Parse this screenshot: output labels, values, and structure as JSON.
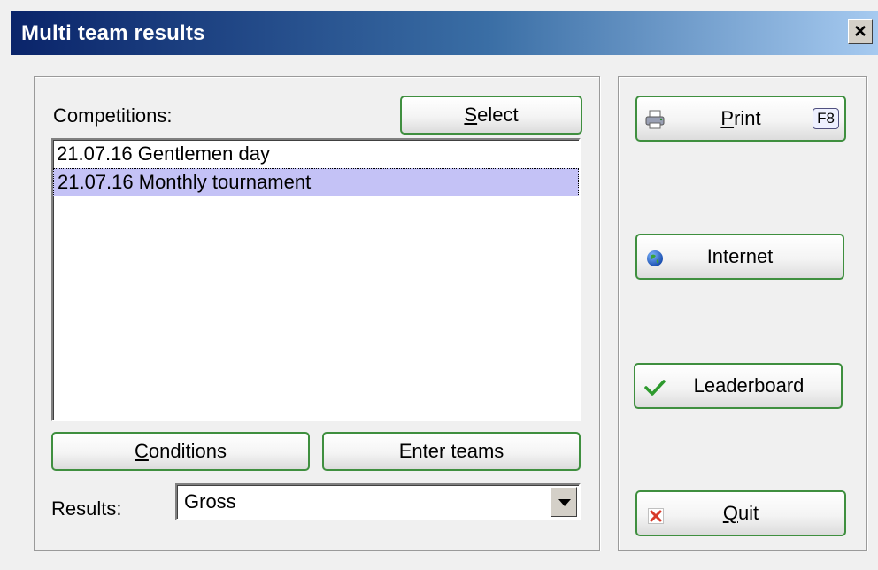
{
  "window": {
    "title": "Multi team results",
    "close_label": "×"
  },
  "left": {
    "competitions_label": "Competitions:",
    "select_button": {
      "mnemonic": "S",
      "rest": "elect"
    },
    "competitions": [
      {
        "label": "21.07.16 Gentlemen day",
        "selected": false
      },
      {
        "label": "21.07.16 Monthly tournament",
        "selected": true
      }
    ],
    "conditions_button": {
      "mnemonic": "C",
      "rest": "onditions"
    },
    "enter_teams_button": "Enter teams",
    "results_label": "Results:",
    "results_value": "Gross"
  },
  "right": {
    "print_button": {
      "mnemonic": "P",
      "rest": "rint",
      "shortcut": "F8",
      "icon": "printer-icon"
    },
    "internet_button": {
      "label": "Internet",
      "icon": "globe-icon"
    },
    "leaderboard_button": {
      "label": "Leaderboard",
      "icon": "checkmark-icon"
    },
    "quit_button": {
      "mnemonic": "Q",
      "rest": "uit",
      "icon": "close-x-icon"
    }
  },
  "colors": {
    "selection": "#c4c2f6",
    "button_border": "#3f8f3f",
    "title_start": "#0a246a",
    "title_end": "#a6caf0"
  }
}
